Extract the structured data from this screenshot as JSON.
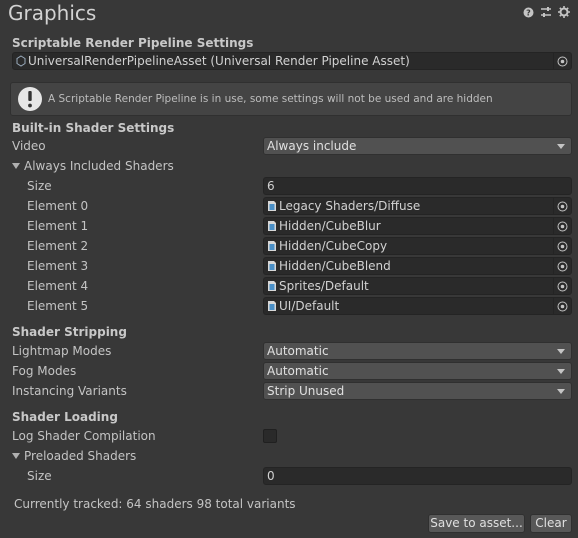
{
  "window": {
    "title": "Graphics",
    "icons": [
      "help-icon",
      "preset-icon",
      "settings-icon"
    ]
  },
  "srp": {
    "heading": "Scriptable Render Pipeline Settings",
    "asset_value": "UniversalRenderPipelineAsset (Universal Render Pipeline Asset)",
    "help_message": "A Scriptable Render Pipeline is in use, some settings will not be used and are hidden"
  },
  "builtin": {
    "heading": "Built-in Shader Settings",
    "video_label": "Video",
    "video_value": "Always include",
    "always_included_label": "Always Included Shaders",
    "size_label": "Size",
    "size_value": "6",
    "elements": [
      {
        "label": "Element 0",
        "value": "Legacy Shaders/Diffuse"
      },
      {
        "label": "Element 1",
        "value": "Hidden/CubeBlur"
      },
      {
        "label": "Element 2",
        "value": "Hidden/CubeCopy"
      },
      {
        "label": "Element 3",
        "value": "Hidden/CubeBlend"
      },
      {
        "label": "Element 4",
        "value": "Sprites/Default"
      },
      {
        "label": "Element 5",
        "value": "UI/Default"
      }
    ]
  },
  "stripping": {
    "heading": "Shader Stripping",
    "lightmap_label": "Lightmap Modes",
    "lightmap_value": "Automatic",
    "fog_label": "Fog Modes",
    "fog_value": "Automatic",
    "instancing_label": "Instancing Variants",
    "instancing_value": "Strip Unused"
  },
  "loading": {
    "heading": "Shader Loading",
    "log_label": "Log Shader Compilation",
    "log_checked": false,
    "preloaded_label": "Preloaded Shaders",
    "size_label": "Size",
    "size_value": "0"
  },
  "footer": {
    "tracked_text": "Currently tracked: 64 shaders 98 total variants",
    "save_label": "Save to asset...",
    "clear_label": "Clear"
  },
  "colors": {
    "background": "#383838",
    "field": "#2a2a2a",
    "dropdown": "#515151",
    "shader_icon": "#4a90c8"
  }
}
